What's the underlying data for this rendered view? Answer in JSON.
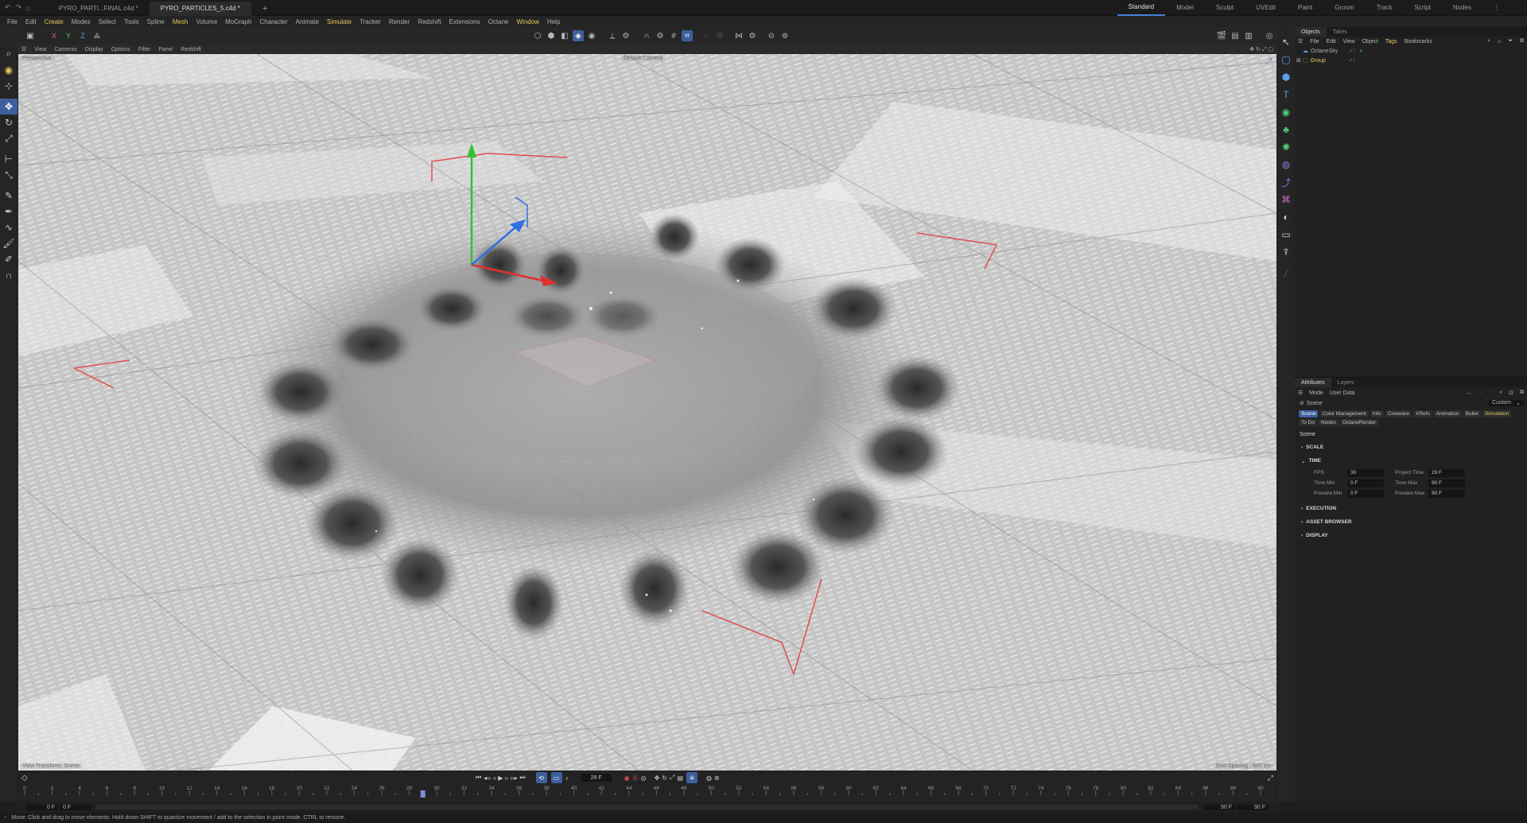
{
  "titlebar": {
    "tabs": [
      {
        "label": "PYRO_PARTI...FINAL.c4d *",
        "active": false
      },
      {
        "label": "PYRO_PARTICLES_5.c4d *",
        "active": true
      }
    ],
    "add_tab": "+",
    "layouts": [
      "Standard",
      "Model",
      "Sculpt",
      "UVEdit",
      "Paint",
      "Groom",
      "Track",
      "Script",
      "Nodes"
    ],
    "active_layout": "Standard"
  },
  "menubar": {
    "items": [
      "File",
      "Edit",
      "Create",
      "Modes",
      "Select",
      "Tools",
      "Spline",
      "Mesh",
      "Volume",
      "MoGraph",
      "Character",
      "Animate",
      "Simulate",
      "Tracker",
      "Render",
      "Redshift",
      "Extensions",
      "Octane",
      "Window",
      "Help"
    ],
    "highlighted": [
      "Create",
      "Mesh",
      "Simulate",
      "Window"
    ]
  },
  "toolbar": {
    "axes": [
      "X",
      "Y",
      "Z"
    ]
  },
  "viewport_menu": {
    "items": [
      "View",
      "Cameras",
      "Display",
      "Options",
      "Filter",
      "Panel",
      "Redshift"
    ]
  },
  "viewport": {
    "projection": "Perspective",
    "camera": "Default Camera",
    "footer_left": "View Transform: Scene",
    "footer_right": "Grid Spacing : 500 cm"
  },
  "objects_panel": {
    "tabs": [
      "Objects",
      "Takes"
    ],
    "menu": [
      "File",
      "Edit",
      "View",
      "Object",
      "Tags",
      "Bookmarks"
    ],
    "rows": [
      {
        "name": "OctaneSky",
        "color": "#b0b0b0"
      },
      {
        "name": "Group",
        "color": "#e6c95a"
      }
    ]
  },
  "attributes_panel": {
    "tabs": [
      "Attributes",
      "Layers"
    ],
    "menu": [
      "Mode",
      "User Data"
    ],
    "breadcrumb": "Scene",
    "preset": "Custom",
    "chips_row1": [
      {
        "label": "Scene",
        "on": true
      },
      {
        "label": "Color Management",
        "on": false
      },
      {
        "label": "Info",
        "on": false
      },
      {
        "label": "Cineware",
        "on": false
      },
      {
        "label": "XRefs",
        "on": false
      },
      {
        "label": "Animation",
        "on": false
      },
      {
        "label": "Bullet",
        "on": false
      },
      {
        "label": "Simulation",
        "on": false
      }
    ],
    "chips_row2": [
      {
        "label": "To Do",
        "on": false
      },
      {
        "label": "Nodes",
        "on": false
      },
      {
        "label": "OctaneRender",
        "on": false
      }
    ],
    "heading": "Scene",
    "sections": {
      "scale": "SCALE",
      "time": "TIME",
      "execution": "EXECUTION",
      "asset_browser": "ASSET BROWSER",
      "display": "DISPLAY"
    },
    "time_fields": {
      "fps_label": "FPS",
      "fps": "30",
      "project_time_label": "Project Time",
      "project_time": "29 F",
      "time_min_label": "Time Min",
      "time_min": "0 F",
      "time_max_label": "Time Max",
      "time_max": "90 F",
      "preview_min_label": "Preview Min",
      "preview_min": "0 F",
      "preview_max_label": "Preview Max",
      "preview_max": "90 F"
    }
  },
  "timeline": {
    "current_frame": "29 F",
    "start_field": "0 F",
    "start_field2": "0 F",
    "end_field": "90 F",
    "end_field2": "90 F",
    "playhead_frame": 29,
    "min_frame": 0,
    "max_frame": 90,
    "tick_labels": [
      "0",
      "2",
      "4",
      "6",
      "8",
      "10",
      "12",
      "14",
      "16",
      "18",
      "20",
      "22",
      "24",
      "26",
      "28",
      "30",
      "32",
      "34",
      "36",
      "38",
      "40",
      "42",
      "44",
      "46",
      "48",
      "50",
      "52",
      "54",
      "56",
      "58",
      "60",
      "62",
      "64",
      "66",
      "68",
      "70",
      "72",
      "74",
      "76",
      "78",
      "80",
      "82",
      "84",
      "86",
      "88",
      "90"
    ]
  },
  "status": {
    "message": "Move: Click and drag to move elements. Hold down SHIFT to quantize movement / add to the selection in point mode. CTRL to remove."
  },
  "colors": {
    "accent": "#3e5f9c",
    "highlight": "#e6c95a",
    "playhead": "#7a8fd6"
  }
}
